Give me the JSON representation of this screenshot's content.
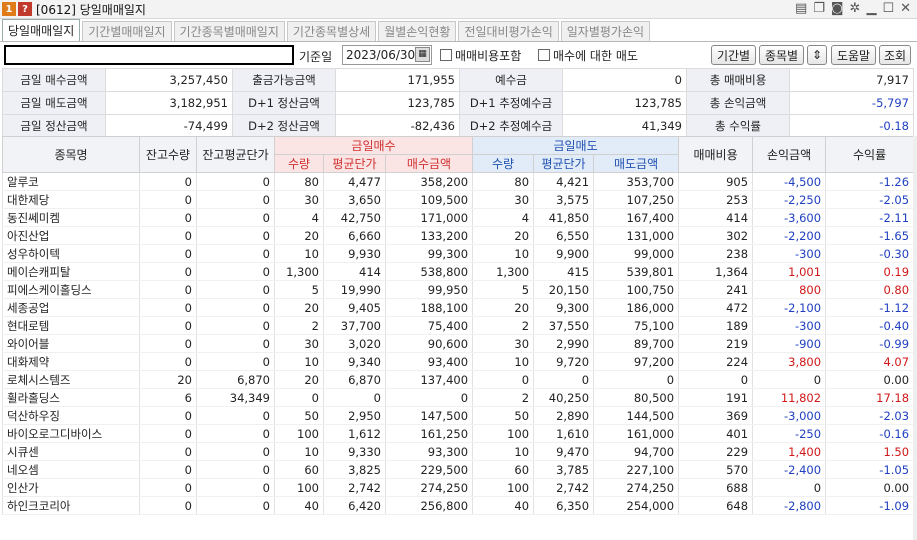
{
  "window": {
    "title": "[0612] 당일매매일지",
    "icon1": "1",
    "icon2": "?"
  },
  "tabs": [
    "당일매매일지",
    "기간별매매일지",
    "기간종목별매매일지",
    "기간종목별상세",
    "월별손익현황",
    "전일대비평가손익",
    "일자별평가손익"
  ],
  "controls": {
    "date_label": "기준일",
    "date_value": "2023/06/30",
    "fee_check": "매매비용포함",
    "buy_sell_check": "매수에 대한 매도",
    "btn_period": "기간별",
    "btn_stock": "종목별",
    "btn_help": "도움말",
    "btn_search": "조회"
  },
  "summary": [
    [
      {
        "k": "금일 매수금액",
        "v": "3,257,450"
      },
      {
        "k": "출금가능금액",
        "v": "171,955"
      },
      {
        "k": "예수금",
        "v": "0"
      },
      {
        "k": "총 매매비용",
        "v": "7,917"
      }
    ],
    [
      {
        "k": "금일 매도금액",
        "v": "3,182,951"
      },
      {
        "k": "D+1 정산금액",
        "v": "123,785"
      },
      {
        "k": "D+1 추정예수금",
        "v": "123,785"
      },
      {
        "k": "총 손익금액",
        "v": "-5,797",
        "neg": true
      }
    ],
    [
      {
        "k": "금일 정산금액",
        "v": "-74,499"
      },
      {
        "k": "D+2 정산금액",
        "v": "-82,436"
      },
      {
        "k": "D+2 추정예수금",
        "v": "41,349"
      },
      {
        "k": "총 수익률",
        "v": "-0.18",
        "neg": true
      }
    ]
  ],
  "headers": {
    "name": "종목명",
    "hold_qty": "잔고수량",
    "hold_avg": "잔고평균단가",
    "buy_group": "금일매수",
    "sell_group": "금일매도",
    "qty": "수량",
    "avg": "평균단가",
    "buy_amt": "매수금액",
    "sell_amt": "매도금액",
    "fee": "매매비용",
    "pnl": "손익금액",
    "rate": "수익률"
  },
  "rows": [
    [
      "알루코",
      "0",
      "0",
      "80",
      "4,477",
      "358,200",
      "80",
      "4,421",
      "353,700",
      "905",
      "-4,500",
      "-1.26"
    ],
    [
      "대한제당",
      "0",
      "0",
      "30",
      "3,650",
      "109,500",
      "30",
      "3,575",
      "107,250",
      "253",
      "-2,250",
      "-2.05"
    ],
    [
      "동진쎄미켐",
      "0",
      "0",
      "4",
      "42,750",
      "171,000",
      "4",
      "41,850",
      "167,400",
      "414",
      "-3,600",
      "-2.11"
    ],
    [
      "아진산업",
      "0",
      "0",
      "20",
      "6,660",
      "133,200",
      "20",
      "6,550",
      "131,000",
      "302",
      "-2,200",
      "-1.65"
    ],
    [
      "성우하이텍",
      "0",
      "0",
      "10",
      "9,930",
      "99,300",
      "10",
      "9,900",
      "99,000",
      "238",
      "-300",
      "-0.30"
    ],
    [
      "메이슨캐피탈",
      "0",
      "0",
      "1,300",
      "414",
      "538,800",
      "1,300",
      "415",
      "539,801",
      "1,364",
      "1,001",
      "0.19"
    ],
    [
      "피에스케이홀딩스",
      "0",
      "0",
      "5",
      "19,990",
      "99,950",
      "5",
      "20,150",
      "100,750",
      "241",
      "800",
      "0.80"
    ],
    [
      "세종공업",
      "0",
      "0",
      "20",
      "9,405",
      "188,100",
      "20",
      "9,300",
      "186,000",
      "472",
      "-2,100",
      "-1.12"
    ],
    [
      "현대로템",
      "0",
      "0",
      "2",
      "37,700",
      "75,400",
      "2",
      "37,550",
      "75,100",
      "189",
      "-300",
      "-0.40"
    ],
    [
      "와이어블",
      "0",
      "0",
      "30",
      "3,020",
      "90,600",
      "30",
      "2,990",
      "89,700",
      "219",
      "-900",
      "-0.99"
    ],
    [
      "대화제약",
      "0",
      "0",
      "10",
      "9,340",
      "93,400",
      "10",
      "9,720",
      "97,200",
      "224",
      "3,800",
      "4.07"
    ],
    [
      "로체시스템즈",
      "20",
      "6,870",
      "20",
      "6,870",
      "137,400",
      "0",
      "0",
      "0",
      "0",
      "0",
      "0.00"
    ],
    [
      "휠라홀딩스",
      "6",
      "34,349",
      "0",
      "0",
      "0",
      "2",
      "40,250",
      "80,500",
      "191",
      "11,802",
      "17.18"
    ],
    [
      "덕산하우징",
      "0",
      "0",
      "50",
      "2,950",
      "147,500",
      "50",
      "2,890",
      "144,500",
      "369",
      "-3,000",
      "-2.03"
    ],
    [
      "바이오로그디바이스",
      "0",
      "0",
      "100",
      "1,612",
      "161,250",
      "100",
      "1,610",
      "161,000",
      "401",
      "-250",
      "-0.16"
    ],
    [
      "시큐센",
      "0",
      "0",
      "10",
      "9,330",
      "93,300",
      "10",
      "9,470",
      "94,700",
      "229",
      "1,400",
      "1.50"
    ],
    [
      "네오셈",
      "0",
      "0",
      "60",
      "3,825",
      "229,500",
      "60",
      "3,785",
      "227,100",
      "570",
      "-2,400",
      "-1.05"
    ],
    [
      "인산가",
      "0",
      "0",
      "100",
      "2,742",
      "274,250",
      "100",
      "2,742",
      "274,250",
      "688",
      "0",
      "0.00"
    ],
    [
      "하인크코리아",
      "0",
      "0",
      "40",
      "6,420",
      "256,800",
      "40",
      "6,350",
      "254,000",
      "648",
      "-2,800",
      "-1.09"
    ]
  ]
}
